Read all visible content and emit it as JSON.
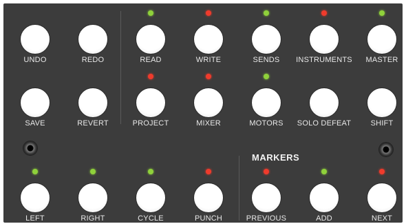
{
  "section": {
    "markers_title": "MARKERS"
  },
  "colors": {
    "panel": "#3c3c3c",
    "led_green": "#8fd13b",
    "led_red": "#ef3b2c"
  },
  "buttons": {
    "undo": {
      "label": "UNDO"
    },
    "redo": {
      "label": "REDO"
    },
    "read": {
      "label": "READ",
      "led": "green"
    },
    "write": {
      "label": "WRITE",
      "led": "red"
    },
    "sends": {
      "label": "SENDS",
      "led": "green"
    },
    "instruments": {
      "label": "INSTRUMENTS",
      "led": "red"
    },
    "master": {
      "label": "MASTER",
      "led": "green"
    },
    "save": {
      "label": "SAVE"
    },
    "revert": {
      "label": "REVERT"
    },
    "project": {
      "label": "PROJECT",
      "led": "red"
    },
    "mixer": {
      "label": "MIXER",
      "led": "red"
    },
    "motors": {
      "label": "MOTORS",
      "led": "green"
    },
    "solo_defeat": {
      "label": "SOLO DEFEAT"
    },
    "shift": {
      "label": "SHIFT"
    },
    "left": {
      "label": "LEFT",
      "led": "green"
    },
    "right": {
      "label": "RIGHT",
      "led": "green"
    },
    "cycle": {
      "label": "CYCLE",
      "led": "green"
    },
    "punch": {
      "label": "PUNCH",
      "led": "red"
    },
    "previous": {
      "label": "PREVIOUS",
      "led": "red"
    },
    "add": {
      "label": "ADD",
      "led": "green"
    },
    "next": {
      "label": "NEXT",
      "led": "red"
    }
  }
}
